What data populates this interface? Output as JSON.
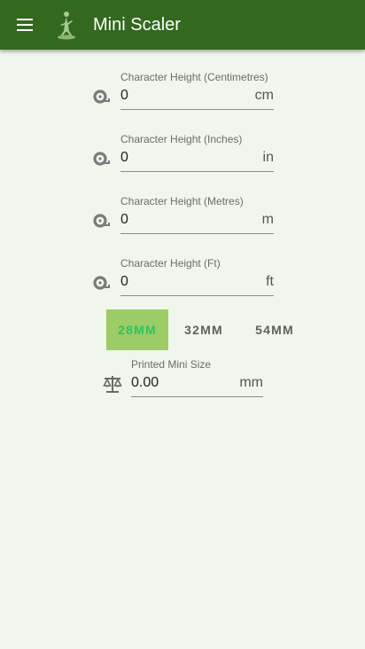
{
  "appbar": {
    "title": "Mini Scaler",
    "menu_icon": "hamburger-menu-icon",
    "logo_icon": "miniature-figure-icon",
    "color": "#33691e"
  },
  "fields": [
    {
      "label": "Character Height (Centimetres)",
      "value": "0",
      "suffix": "cm",
      "icon": "ruler-tape-icon"
    },
    {
      "label": "Character Height (Inches)",
      "value": "0",
      "suffix": "in",
      "icon": "ruler-tape-icon"
    },
    {
      "label": "Character Height (Metres)",
      "value": "0",
      "suffix": "m",
      "icon": "ruler-tape-icon"
    },
    {
      "label": "Character Height (Ft)",
      "value": "0",
      "suffix": "ft",
      "icon": "ruler-tape-icon"
    }
  ],
  "scales": {
    "options": [
      "28MM",
      "32MM",
      "54MM"
    ],
    "selected": "28MM",
    "selected_bg": "#9ccc65",
    "selected_text": "#2ec35f"
  },
  "printed": {
    "label": "Printed Mini Size",
    "value": "0.00",
    "suffix": "mm",
    "icon": "scale-balance-icon"
  },
  "background": "#f1f6ec"
}
